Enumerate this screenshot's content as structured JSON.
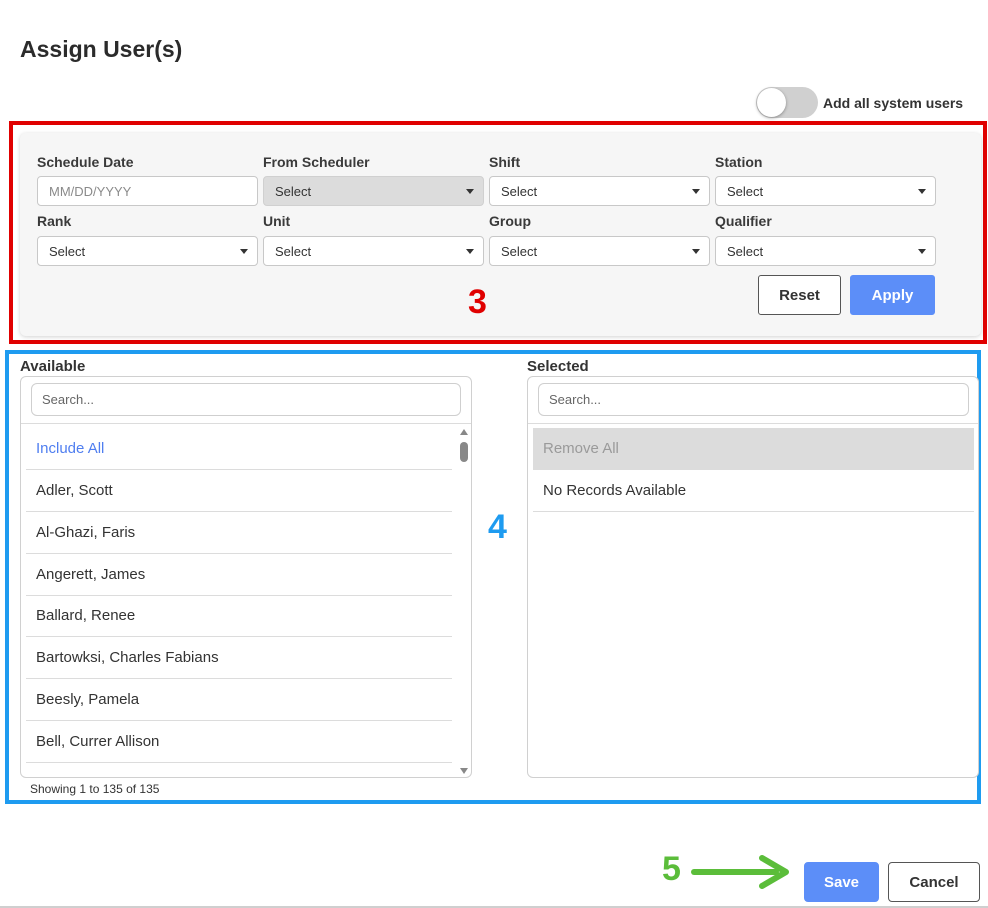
{
  "dialog": {
    "title": "Assign User(s)"
  },
  "toggle": {
    "label": "Add all system users",
    "on": false
  },
  "filters": {
    "schedule_date": {
      "label": "Schedule Date",
      "placeholder": "MM/DD/YYYY"
    },
    "from_scheduler": {
      "label": "From Scheduler",
      "value": "Select",
      "disabled": true
    },
    "shift": {
      "label": "Shift",
      "value": "Select"
    },
    "station": {
      "label": "Station",
      "value": "Select"
    },
    "rank": {
      "label": "Rank",
      "value": "Select"
    },
    "unit": {
      "label": "Unit",
      "value": "Select"
    },
    "group": {
      "label": "Group",
      "value": "Select"
    },
    "qualifier": {
      "label": "Qualifier",
      "value": "Select"
    },
    "reset_label": "Reset",
    "apply_label": "Apply"
  },
  "annotations": {
    "step3": "3",
    "step4": "4",
    "step5": "5",
    "colors": {
      "red": "#e00000",
      "blue": "#1e9bf0",
      "green": "#5bbd3a"
    }
  },
  "available": {
    "title": "Available",
    "search_placeholder": "Search...",
    "include_all": "Include All",
    "items": [
      "Adler, Scott",
      "Al-Ghazi, Faris",
      "Angerett, James",
      "Ballard, Renee",
      "Bartowksi, Charles Fabians",
      "Beesly, Pamela",
      "Bell, Currer Allison"
    ],
    "status": "Showing 1 to 135 of 135"
  },
  "selected": {
    "title": "Selected",
    "search_placeholder": "Search...",
    "remove_all": "Remove All",
    "empty_text": "No Records Available"
  },
  "footer": {
    "save_label": "Save",
    "cancel_label": "Cancel"
  },
  "colors": {
    "primary": "#5c8ef8",
    "link": "#4f7ef0"
  }
}
